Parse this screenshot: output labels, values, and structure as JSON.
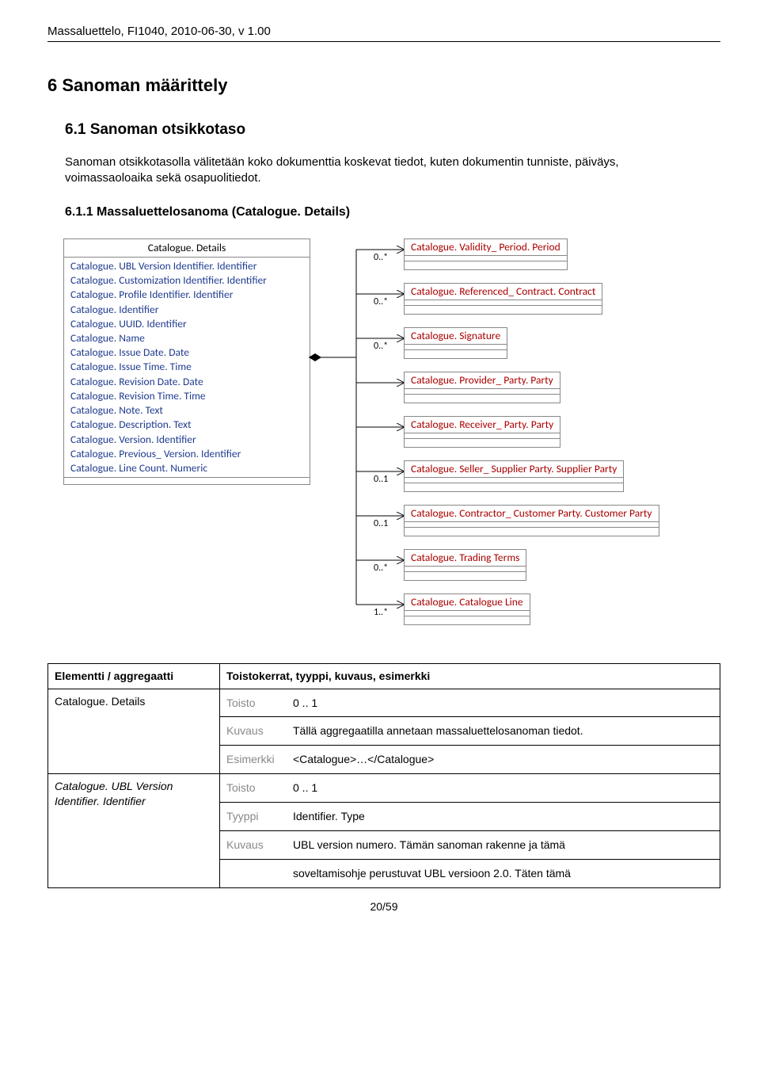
{
  "header": "Massaluettelo, FI1040, 2010-06-30, v 1.00",
  "sections": {
    "s6": "6   Sanoman määrittely",
    "s61": "6.1  Sanoman otsikkotaso",
    "intro": "Sanoman otsikkotasolla välitetään koko dokumenttia koskevat tiedot, kuten dokumentin tunniste, päiväys, voimassaoloaika sekä osapuolitiedot.",
    "s611": "6.1.1  Massaluettelosanoma (Catalogue. Details)"
  },
  "mainBox": {
    "title": "Catalogue. Details",
    "attrs": [
      "Catalogue. UBL Version Identifier. Identifier",
      "Catalogue. Customization Identifier. Identifier",
      "Catalogue. Profile Identifier. Identifier",
      "Catalogue. Identifier",
      "Catalogue. UUID. Identifier",
      "Catalogue. Name",
      "Catalogue. Issue Date. Date",
      "Catalogue. Issue Time. Time",
      "Catalogue. Revision Date. Date",
      "Catalogue. Revision Time. Time",
      "Catalogue. Note. Text",
      "Catalogue. Description. Text",
      "Catalogue. Version. Identifier",
      "Catalogue. Previous_ Version. Identifier",
      "Catalogue. Line Count. Numeric"
    ]
  },
  "assocs": [
    {
      "mult": "0..*",
      "title": "Catalogue. Validity_ Period. Period"
    },
    {
      "mult": "0..*",
      "title": "Catalogue. Referenced_ Contract. Contract"
    },
    {
      "mult": "0..*",
      "title": "Catalogue. Signature"
    },
    {
      "mult": "",
      "title": "Catalogue. Provider_ Party. Party"
    },
    {
      "mult": "",
      "title": "Catalogue. Receiver_ Party. Party"
    },
    {
      "mult": "0..1",
      "title": "Catalogue. Seller_ Supplier Party. Supplier Party"
    },
    {
      "mult": "0..1",
      "title": "Catalogue. Contractor_ Customer Party. Customer Party"
    },
    {
      "mult": "0..*",
      "title": "Catalogue. Trading Terms"
    },
    {
      "mult": "1..*",
      "title": "Catalogue. Catalogue Line"
    }
  ],
  "tableHead": {
    "c1": "Elementti / aggregaatti",
    "c2": "Toistokerrat, tyyppi, kuvaus, esimerkki"
  },
  "tableRows": [
    {
      "name": "Catalogue. Details",
      "lines": [
        {
          "label": "Toisto",
          "value": "0  ..  1"
        },
        {
          "label": "Kuvaus",
          "value": "Tällä aggregaatilla annetaan massaluettelosanoman tiedot."
        },
        {
          "label": "Esimerkki",
          "value": "<Catalogue>…</Catalogue>"
        }
      ]
    },
    {
      "name": "Catalogue. UBL Version Identifier. Identifier",
      "nameItalic": true,
      "lines": [
        {
          "label": "Toisto",
          "value": "0  ..  1"
        },
        {
          "label": "Tyyppi",
          "value": "Identifier. Type"
        },
        {
          "label": "Kuvaus",
          "value": "UBL version numero. Tämän sanoman rakenne ja tämä"
        },
        {
          "label": "",
          "value": "soveltamisohje perustuvat UBL versioon 2.0. Täten tämä"
        }
      ]
    }
  ],
  "pageNum": "20/59"
}
